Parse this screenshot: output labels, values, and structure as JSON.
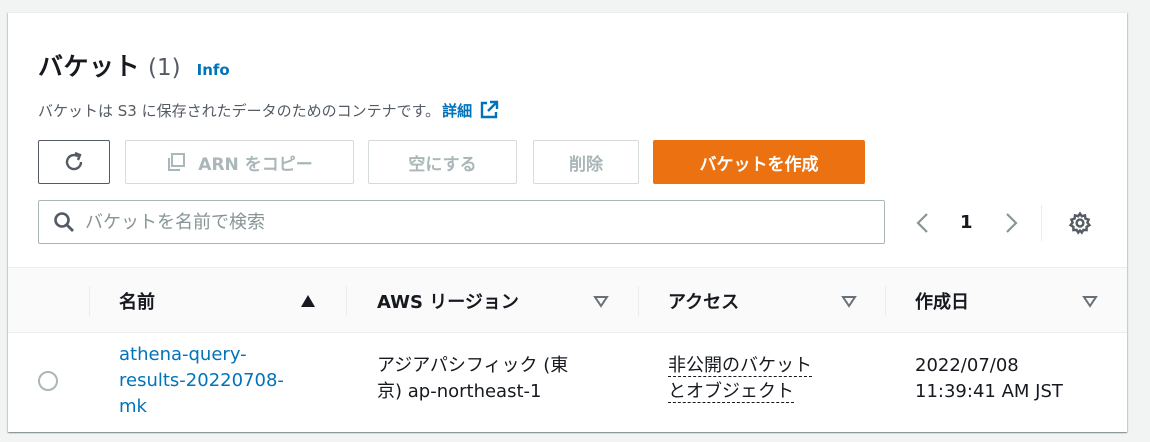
{
  "header": {
    "title": "バケット",
    "count": "(1)",
    "info_link": "Info",
    "description": "バケットは S3 に保存されたデータのためのコンテナです。",
    "detail_link": "詳細"
  },
  "toolbar": {
    "refresh_icon": "refresh-icon",
    "copy_arn_label": "ARN をコピー",
    "empty_label": "空にする",
    "delete_label": "削除",
    "create_label": "バケットを作成"
  },
  "search": {
    "placeholder": "バケットを名前で検索",
    "value": ""
  },
  "pagination": {
    "current_page": "1"
  },
  "table": {
    "columns": [
      {
        "label": "名前",
        "sort": "ascending"
      },
      {
        "label": "AWS リージョン",
        "sort": "none"
      },
      {
        "label": "アクセス",
        "sort": "none"
      },
      {
        "label": "作成日",
        "sort": "none"
      }
    ],
    "rows": [
      {
        "name_line1": "athena-query-",
        "name_line2": "results-20220708-",
        "name_line3": "mk",
        "region_line1": "アジアパシフィック (東",
        "region_line2": "京) ap-northeast-1",
        "access_line1": "非公開のバケット",
        "access_line2": "とオブジェクト",
        "created_line1": "2022/07/08",
        "created_line2": "11:39:41 AM JST"
      }
    ]
  },
  "colors": {
    "primary_button": "#ec7211",
    "link": "#0073bb",
    "disabled_text": "#aab7b8"
  }
}
